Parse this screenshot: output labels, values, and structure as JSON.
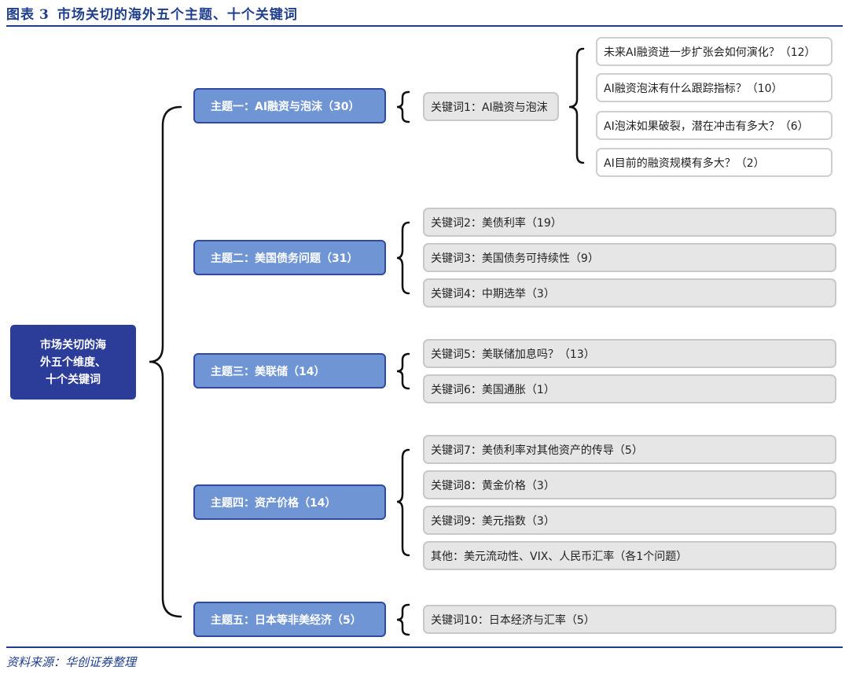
{
  "figure": {
    "label": "图表",
    "number": "3",
    "title": "市场关切的海外五个主题、十个关键词",
    "source": "资料来源：华创证券整理"
  },
  "root": {
    "line1": "市场关切的海",
    "line2": "外五个维度、",
    "line3": "十个关键词"
  },
  "topics": [
    "主题一：AI融资与泡沫（30）",
    "主题二：美国债务问题（31）",
    "主题三：美联储（14）",
    "主题四：资产价格（14）",
    "主题五：日本等非美经济（5）"
  ],
  "keywords": {
    "t1": [
      "关键词1：AI融资与泡沫"
    ],
    "t2": [
      "关键词2：美债利率（19）",
      "关键词3：美国债务可持续性（9）",
      "关键词4：中期选举（3）"
    ],
    "t3": [
      "关键词5：美联储加息吗？（13）",
      "关键词6：美国通胀（1）"
    ],
    "t4": [
      "关键词7：美债利率对其他资产的传导（5）",
      "关键词8：黄金价格（3）",
      "关键词9：美元指数（3）",
      "其他：美元流动性、VIX、人民币汇率（各1个问题）"
    ],
    "t5": [
      "关键词10：日本经济与汇率（5）"
    ]
  },
  "questions": [
    "未来AI融资进一步扩张会如何演化？（12）",
    "AI融资泡沫有什么跟踪指标？（10）",
    "AI泡沫如果破裂，潜在冲击有多大？（6）",
    "AI目前的融资规模有多大？（2）"
  ]
}
